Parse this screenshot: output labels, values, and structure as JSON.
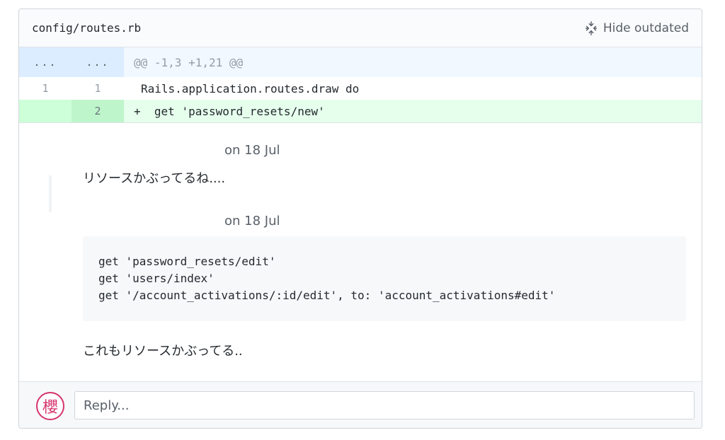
{
  "file": {
    "path": "config/routes.rb",
    "hide_outdated_label": "Hide outdated"
  },
  "diff": {
    "hunk": {
      "old": "...",
      "new": "...",
      "text": "@@ -1,3 +1,21 @@"
    },
    "lines": [
      {
        "old": "1",
        "new": "1",
        "marker": "",
        "code": "Rails.application.routes.draw do"
      },
      {
        "old": "",
        "new": "2",
        "marker": "+",
        "code": "get 'password_resets/new'"
      }
    ]
  },
  "comments": [
    {
      "date": "on 18 Jul",
      "text": "リソースかぶってるね...."
    },
    {
      "date": "on 18 Jul",
      "code": "get 'password_resets/edit'\nget 'users/index'\nget '/account_activations/:id/edit', to: 'account_activations#edit'",
      "text": "これもリソースかぶってる.."
    }
  ],
  "reply": {
    "avatar_glyph": "櫻",
    "placeholder": "Reply..."
  }
}
